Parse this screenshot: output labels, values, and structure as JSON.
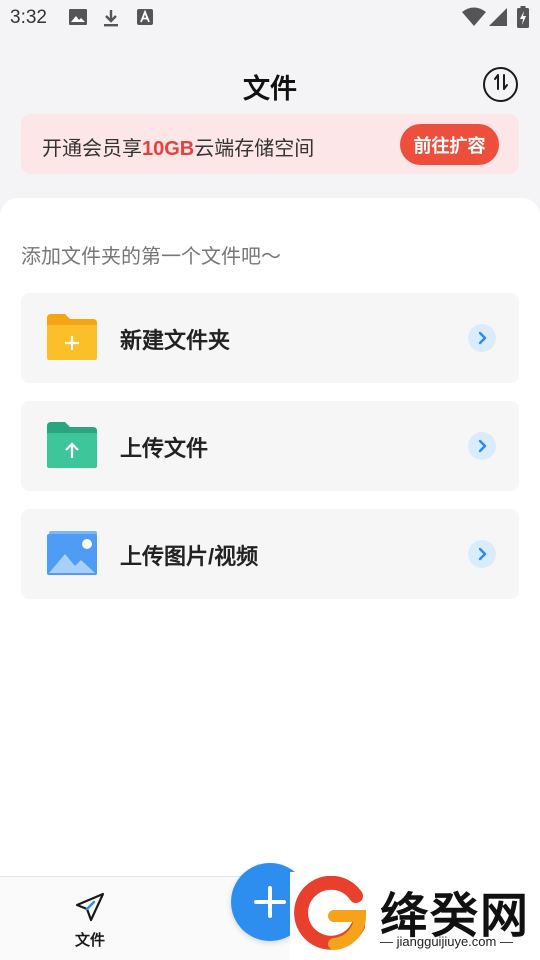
{
  "status_bar": {
    "time": "3:32",
    "left_icons": [
      "image-icon",
      "download-icon",
      "text-a-icon"
    ],
    "right_icons": [
      "wifi-icon",
      "signal-icon",
      "battery-icon"
    ]
  },
  "header": {
    "title": "文件",
    "sort_icon": "sort-arrows-icon"
  },
  "banner": {
    "text_before": "开通会员享",
    "text_highlight": "10GB",
    "text_after": "云端存储空间",
    "button_label": "前往扩容",
    "accent_color": "#ee4f3c"
  },
  "main": {
    "hint": "添加文件夹的第一个文件吧～",
    "actions": [
      {
        "label": "新建文件夹",
        "icon": "new-folder-icon",
        "color": "#f8b41c"
      },
      {
        "label": "上传文件",
        "icon": "upload-folder-icon",
        "color": "#3cc296"
      },
      {
        "label": "上传图片/视频",
        "icon": "image-upload-icon",
        "color": "#4e9cf3"
      }
    ]
  },
  "bottom_nav": {
    "files_label": "文件",
    "files_icon": "paper-plane-icon",
    "fab_icon": "plus-icon"
  },
  "watermark": {
    "brand": "绛癸网",
    "url": "jiangguijiuye.com"
  }
}
